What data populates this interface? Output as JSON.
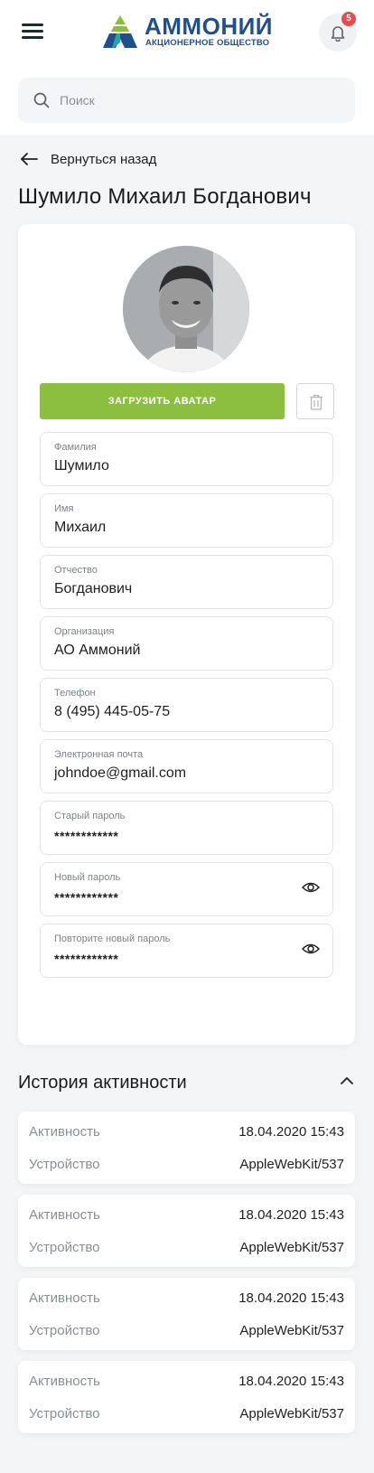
{
  "header": {
    "logo_title": "АММОНИЙ",
    "logo_subtitle": "АКЦИОНЕРНОЕ ОБЩЕСТВО",
    "notification_count": "5",
    "brand_color": "#1f4f8c"
  },
  "search": {
    "placeholder": "Поиск"
  },
  "nav": {
    "back_label": "Вернуться назад"
  },
  "page": {
    "title": "Шумило Михаил Богданович"
  },
  "profile": {
    "upload_label": "ЗАГРУЗИТЬ АВАТАР",
    "accent": "#8cbf3f",
    "fields": [
      {
        "label": "Фамилия",
        "value": "Шумило"
      },
      {
        "label": "Имя",
        "value": "Михаил"
      },
      {
        "label": "Отчество",
        "value": "Богданович"
      },
      {
        "label": "Организация",
        "value": "АО Аммоний"
      },
      {
        "label": "Телефон",
        "value": "8 (495) 445-05-75"
      },
      {
        "label": "Электронная почта",
        "value": "johndoe@gmail.com"
      },
      {
        "label": "Старый пароль",
        "value": "************"
      },
      {
        "label": "Новый пароль",
        "value": "************"
      },
      {
        "label": "Повторите новый пароль",
        "value": "************"
      }
    ]
  },
  "history": {
    "title": "История активности",
    "items": [
      {
        "activity_label": "Активность",
        "activity_value": "18.04.2020 15:43",
        "device_label": "Устройство",
        "device_value": "AppleWebKit/537"
      },
      {
        "activity_label": "Активность",
        "activity_value": "18.04.2020 15:43",
        "device_label": "Устройство",
        "device_value": "AppleWebKit/537"
      },
      {
        "activity_label": "Активность",
        "activity_value": "18.04.2020 15:43",
        "device_label": "Устройство",
        "device_value": "AppleWebKit/537"
      },
      {
        "activity_label": "Активность",
        "activity_value": "18.04.2020 15:43",
        "device_label": "Устройство",
        "device_value": "AppleWebKit/537"
      }
    ]
  }
}
